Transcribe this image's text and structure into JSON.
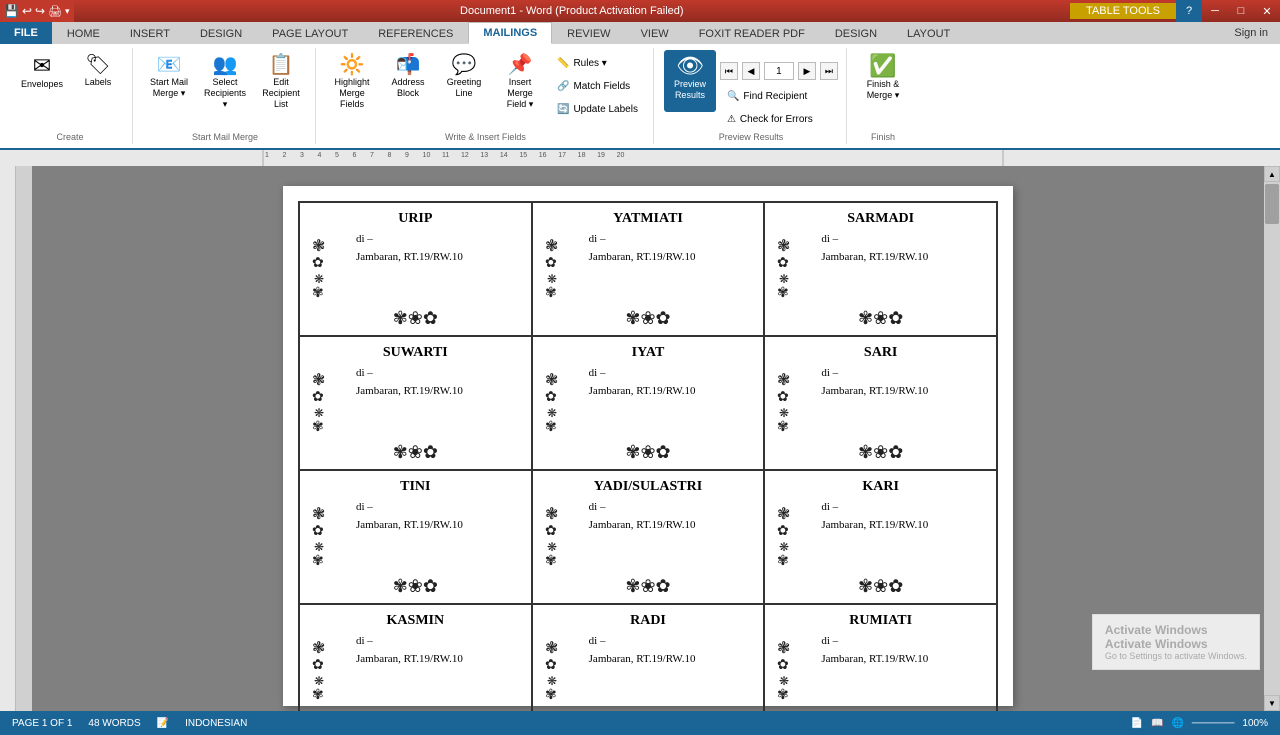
{
  "titlebar": {
    "title": "Document1 - Word (Product Activation Failed)",
    "table_tools_label": "TABLE TOOLS",
    "qa_icons": [
      "💾",
      "🔄",
      "↩",
      "↪",
      "🖨️"
    ]
  },
  "tabs": {
    "items": [
      "FILE",
      "HOME",
      "INSERT",
      "DESIGN",
      "PAGE LAYOUT",
      "REFERENCES",
      "MAILINGS",
      "REVIEW",
      "VIEW",
      "FOXIT READER PDF",
      "DESIGN",
      "LAYOUT"
    ],
    "active": "MAILINGS"
  },
  "ribbon": {
    "groups": [
      {
        "label": "Create",
        "items": [
          {
            "id": "envelopes",
            "icon": "✉",
            "label": "Envelopes"
          },
          {
            "id": "labels",
            "icon": "🏷",
            "label": "Labels"
          }
        ]
      },
      {
        "label": "Start Mail Merge",
        "items": [
          {
            "id": "start-mail-merge",
            "icon": "📧",
            "label": "Start Mail\nMerge ▾"
          },
          {
            "id": "select-recipients",
            "icon": "👥",
            "label": "Select\nRecipients ▾"
          },
          {
            "id": "edit-recipient-list",
            "icon": "📋",
            "label": "Edit\nRecipient List"
          }
        ]
      },
      {
        "label": "Write & Insert Fields",
        "items": [
          {
            "id": "highlight",
            "icon": "🔆",
            "label": "Highlight\nMerge Fields"
          },
          {
            "id": "address-block",
            "icon": "📬",
            "label": "Address\nBlock"
          },
          {
            "id": "greeting-line",
            "icon": "💬",
            "label": "Greeting\nLine"
          },
          {
            "id": "insert-merge-field",
            "icon": "📌",
            "label": "Insert Merge\nField ▾"
          },
          {
            "id": "rules",
            "icon": "📏",
            "label": "Rules ▾"
          },
          {
            "id": "match-fields",
            "icon": "🔗",
            "label": "Match Fields"
          },
          {
            "id": "update-labels",
            "icon": "🔄",
            "label": "Update Labels"
          }
        ]
      },
      {
        "label": "Preview Results",
        "items": [
          {
            "id": "preview-results",
            "icon": "👁",
            "label": "Preview\nResults",
            "active": true
          },
          {
            "id": "nav-prev-prev",
            "icon": "⏮",
            "label": ""
          },
          {
            "id": "nav-prev",
            "icon": "◀",
            "label": ""
          },
          {
            "id": "nav-num",
            "value": "1",
            "label": ""
          },
          {
            "id": "nav-next",
            "icon": "▶",
            "label": ""
          },
          {
            "id": "nav-next-next",
            "icon": "⏭",
            "label": ""
          },
          {
            "id": "find-recipient",
            "icon": "🔍",
            "label": "Find Recipient"
          },
          {
            "id": "check-errors",
            "icon": "⚠",
            "label": "Check for Errors"
          }
        ]
      },
      {
        "label": "Finish",
        "items": [
          {
            "id": "finish-merge",
            "icon": "✅",
            "label": "Finish &\nMerge ▾"
          }
        ]
      }
    ]
  },
  "sign_in": "Sign in",
  "document": {
    "cards": [
      {
        "name": "URIP",
        "line1": "di –",
        "line2": "Jambaran, RT.19/RW.10"
      },
      {
        "name": "YATMIATI",
        "line1": "di –",
        "line2": "Jambaran, RT.19/RW.10"
      },
      {
        "name": "SARMADI",
        "line1": "di –",
        "line2": "Jambaran, RT.19/RW.10"
      },
      {
        "name": "SUWARTI",
        "line1": "di –",
        "line2": "Jambaran, RT.19/RW.10"
      },
      {
        "name": "IYAT",
        "line1": "di –",
        "line2": "Jambaran, RT.19/RW.10"
      },
      {
        "name": "SARI",
        "line1": "di –",
        "line2": "Jambaran, RT.19/RW.10"
      },
      {
        "name": "TINI",
        "line1": "di –",
        "line2": "Jambaran, RT.19/RW.10"
      },
      {
        "name": "YADI/SULASTRI",
        "line1": "di –",
        "line2": "Jambaran, RT.19/RW.10"
      },
      {
        "name": "KARI",
        "line1": "di –",
        "line2": "Jambaran, RT.19/RW.10"
      },
      {
        "name": "KASMIN",
        "line1": "di –",
        "line2": "Jambaran, RT.19/RW.10"
      },
      {
        "name": "RADI",
        "line1": "di –",
        "line2": "Jambaran, RT.19/RW.10"
      },
      {
        "name": "RUMIATI",
        "line1": "di –",
        "line2": "Jambaran, RT.19/RW.10"
      }
    ]
  },
  "status_bar": {
    "page": "PAGE 1 OF 1",
    "words": "48 WORDS",
    "language": "INDONESIAN",
    "zoom": "100%"
  },
  "watermark": {
    "line1": "Activate Windows",
    "line2": "Activate Windows",
    "line3": "Go to Settings to activate Windows."
  }
}
